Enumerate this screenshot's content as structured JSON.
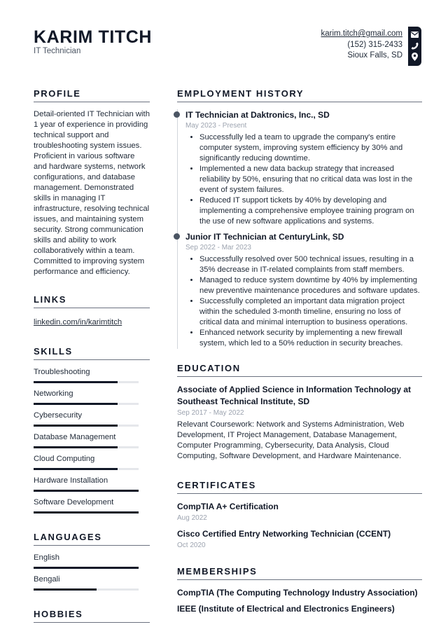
{
  "header": {
    "name": "KARIM TITCH",
    "title": "IT Technician",
    "email": "karim.titch@gmail.com",
    "phone": "(152) 315-2433",
    "location": "Sioux Falls, SD",
    "icons": [
      "envelope-icon",
      "phone-icon",
      "map-pin-icon"
    ]
  },
  "profile": {
    "title": "PROFILE",
    "text": "Detail-oriented IT Technician with 1 year of experience in providing technical support and troubleshooting system issues. Proficient in various software and hardware systems, network configurations, and database management. Demonstrated skills in managing IT infrastructure, resolving technical issues, and maintaining system security. Strong communication skills and ability to work collaboratively within a team. Committed to improving system performance and efficiency."
  },
  "links": {
    "title": "LINKS",
    "items": [
      "linkedin.com/in/karimtitch"
    ]
  },
  "skills": {
    "title": "SKILLS",
    "items": [
      {
        "name": "Troubleshooting",
        "level": 0.8
      },
      {
        "name": "Networking",
        "level": 0.8
      },
      {
        "name": "Cybersecurity",
        "level": 0.8
      },
      {
        "name": "Database Management",
        "level": 0.8
      },
      {
        "name": "Cloud Computing",
        "level": 0.8
      },
      {
        "name": "Hardware Installation",
        "level": 1.0
      },
      {
        "name": "Software Development",
        "level": 1.0
      }
    ]
  },
  "languages": {
    "title": "LANGUAGES",
    "items": [
      {
        "name": "English",
        "level": 1.0
      },
      {
        "name": "Bengali",
        "level": 0.6
      }
    ]
  },
  "hobbies": {
    "title": "HOBBIES"
  },
  "employment": {
    "title": "EMPLOYMENT HISTORY",
    "jobs": [
      {
        "heading": "IT Technician at Daktronics, Inc., SD",
        "dates": "May 2023 - Present",
        "bullets": [
          "Successfully led a team to upgrade the company's entire computer system, improving system efficiency by 30% and significantly reducing downtime.",
          "Implemented a new data backup strategy that increased reliability by 50%, ensuring that no critical data was lost in the event of system failures.",
          "Reduced IT support tickets by 40% by developing and implementing a comprehensive employee training program on the use of new software applications and systems."
        ]
      },
      {
        "heading": "Junior IT Technician at CenturyLink, SD",
        "dates": "Sep 2022 - Mar 2023",
        "bullets": [
          "Successfully resolved over 500 technical issues, resulting in a 35% decrease in IT-related complaints from staff members.",
          "Managed to reduce system downtime by 40% by implementing new preventive maintenance procedures and software updates.",
          "Successfully completed an important data migration project within the scheduled 3-month timeline, ensuring no loss of critical data and minimal interruption to business operations.",
          "Enhanced network security by implementing a new firewall system, which led to a 50% reduction in security breaches."
        ]
      }
    ]
  },
  "education": {
    "title": "EDUCATION",
    "items": [
      {
        "heading": "Associate of Applied Science in Information Technology at Southeast Technical Institute, SD",
        "dates": "Sep 2017 - May 2022",
        "description": "Relevant Coursework: Network and Systems Administration, Web Development, IT Project Management, Database Management, Computer Programming, Cybersecurity, Data Analysis, Cloud Computing, Software Development, and Hardware Maintenance."
      }
    ]
  },
  "certificates": {
    "title": "CERTIFICATES",
    "items": [
      {
        "name": "CompTIA A+ Certification",
        "date": "Aug 2022"
      },
      {
        "name": "Cisco Certified Entry Networking Technician (CCENT)",
        "date": "Oct 2020"
      }
    ]
  },
  "memberships": {
    "title": "MEMBERSHIPS",
    "items": [
      "CompTIA (The Computing Technology Industry Association)",
      "IEEE (Institute of Electrical and Electronics Engineers)"
    ]
  }
}
